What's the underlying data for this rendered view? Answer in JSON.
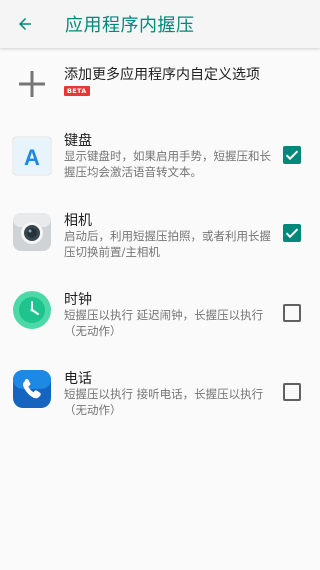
{
  "header": {
    "title": "应用程序内握压",
    "back_icon": "arrow-back-icon",
    "accent_color": "#00897b"
  },
  "add_custom": {
    "label": "添加更多应用程序内自定义选项",
    "badge": "BETA",
    "icon": "plus-icon"
  },
  "apps": [
    {
      "name": "键盘",
      "desc": "显示键盘时，如果启用手势，短握压和长握压均会激活语音转文本。",
      "checked": true,
      "icon": "keyboard-app-icon"
    },
    {
      "name": "相机",
      "desc": "启动后，利用短握压拍照，或者利用长握压切换前置/主相机",
      "checked": true,
      "icon": "camera-app-icon"
    },
    {
      "name": "时钟",
      "desc": "短握压以执行 延迟闹钟，长握压以执行 （无动作）",
      "checked": false,
      "icon": "clock-app-icon"
    },
    {
      "name": "电话",
      "desc": "短握压以执行 接听电话，长握压以执行 （无动作）",
      "checked": false,
      "icon": "phone-app-icon"
    }
  ]
}
